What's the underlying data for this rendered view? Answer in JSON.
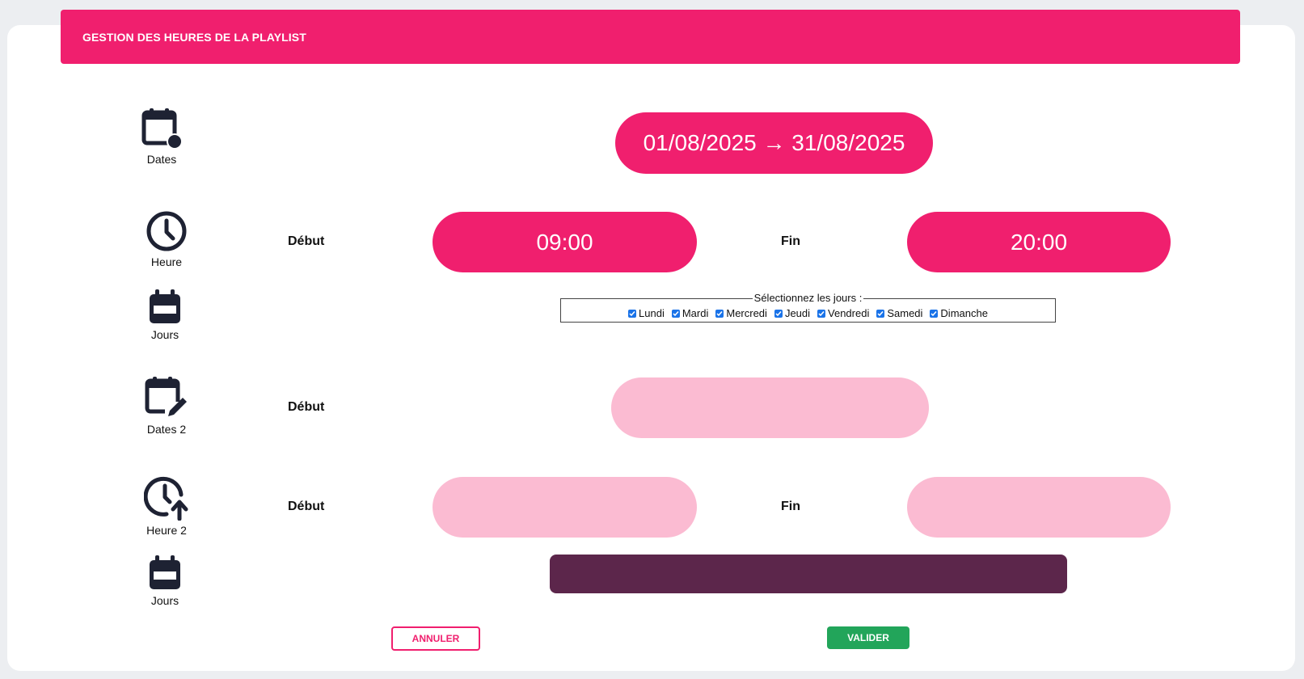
{
  "header": {
    "title": "GESTION DES HEURES DE LA PLAYLIST"
  },
  "rows": {
    "dates": {
      "icon": "calendar-dot-icon",
      "label": "Dates",
      "value": "01/08/2025 → 31/08/2025"
    },
    "heure": {
      "icon": "clock-icon",
      "label": "Heure",
      "start_label": "Début",
      "start_value": "09:00",
      "end_label": "Fin",
      "end_value": "20:00"
    },
    "jours": {
      "icon": "calendar-icon",
      "label": "Jours",
      "legend": "Sélectionnez les jours :",
      "days": [
        {
          "name": "Lundi",
          "checked": true
        },
        {
          "name": "Mardi",
          "checked": true
        },
        {
          "name": "Mercredi",
          "checked": true
        },
        {
          "name": "Jeudi",
          "checked": true
        },
        {
          "name": "Vendredi",
          "checked": true
        },
        {
          "name": "Samedi",
          "checked": true
        },
        {
          "name": "Dimanche",
          "checked": true
        }
      ]
    },
    "dates2": {
      "icon": "calendar-edit-icon",
      "label": "Dates 2",
      "start_label": "Début",
      "value": ""
    },
    "heure2": {
      "icon": "clock-arrow-up-icon",
      "label": "Heure 2",
      "start_label": "Début",
      "start_value": "",
      "end_label": "Fin",
      "end_value": ""
    },
    "jours2": {
      "icon": "calendar-icon",
      "label": "Jours"
    }
  },
  "actions": {
    "cancel": "ANNULER",
    "confirm": "VALIDER"
  },
  "colors": {
    "accent": "#f01f6e",
    "accent_light": "#fbbbd2",
    "dark_bar": "#5c264b",
    "confirm": "#22a55a",
    "icon": "#1e2233"
  }
}
